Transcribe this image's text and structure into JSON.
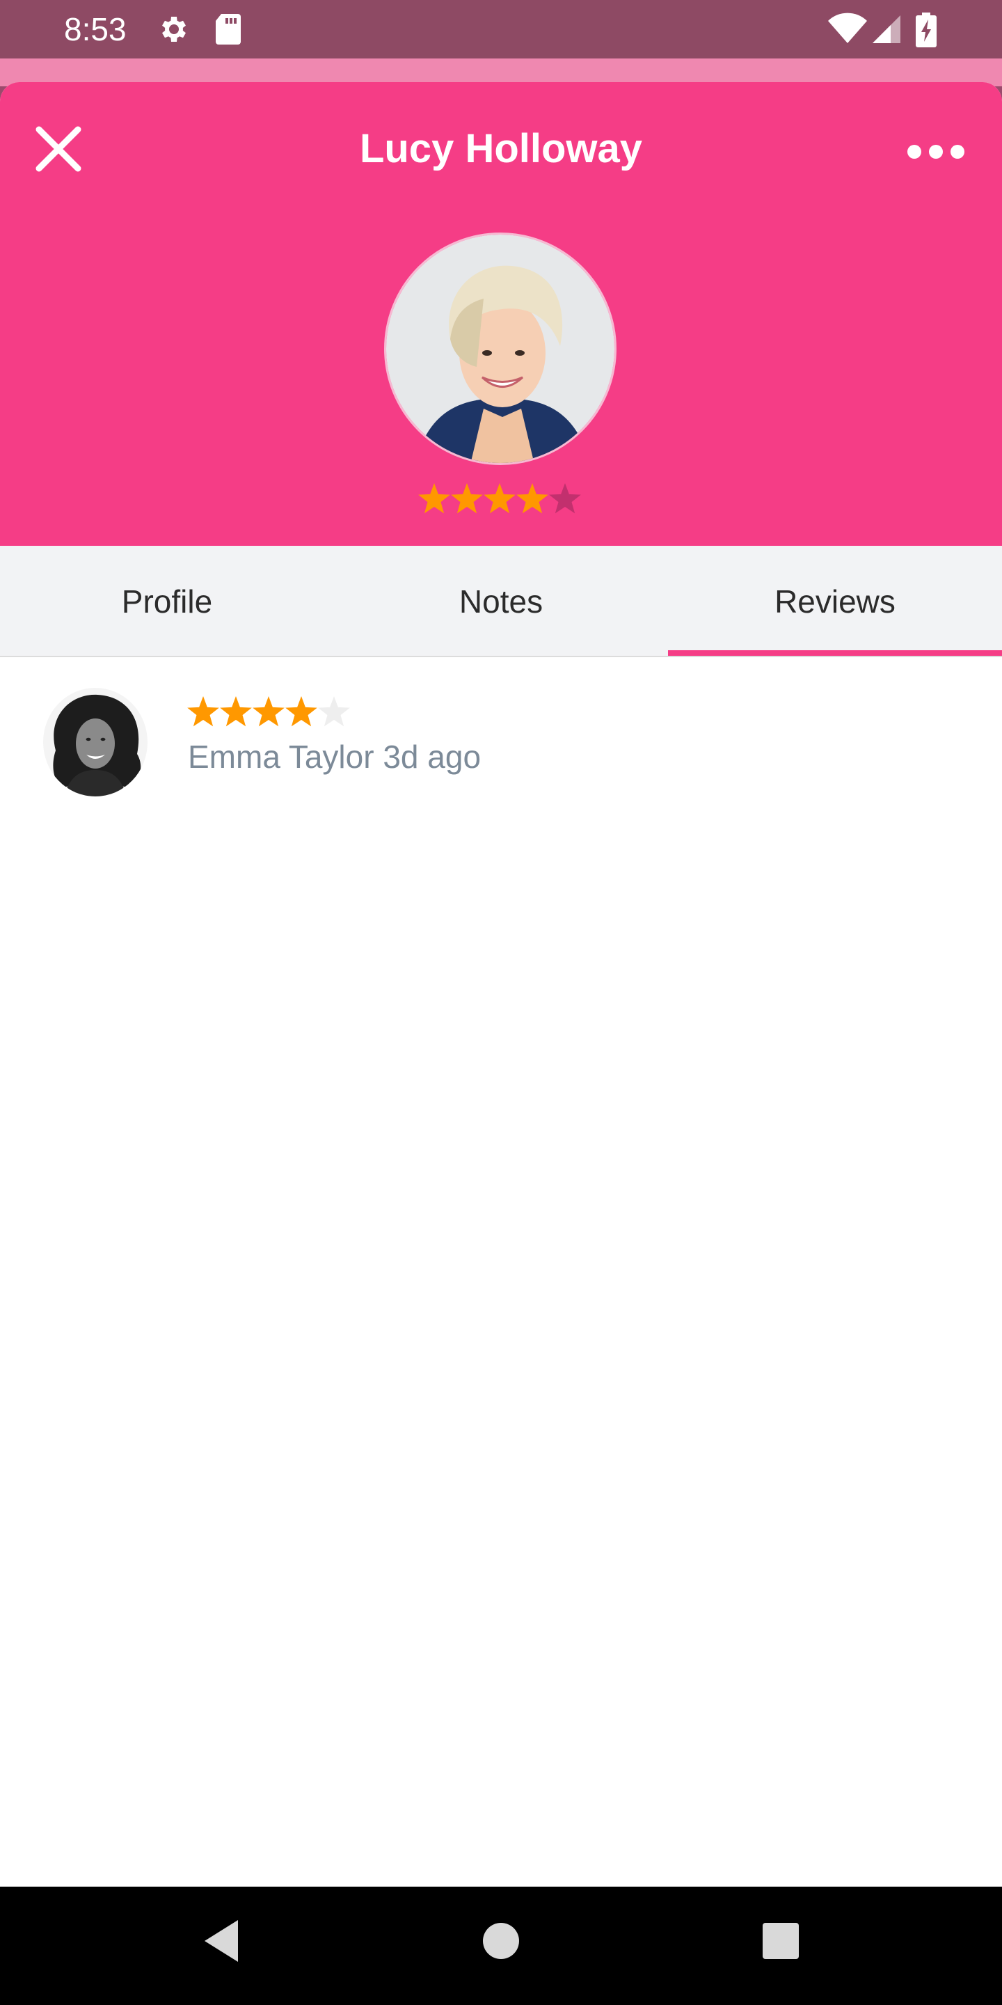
{
  "status_bar": {
    "time": "8:53",
    "icons": [
      "gear-icon",
      "sd-card-icon",
      "wifi-icon",
      "signal-icon",
      "battery-charging-icon"
    ]
  },
  "header": {
    "title": "Lucy Holloway",
    "close_icon": "close-icon",
    "more_icon": "more-horizontal-icon",
    "rating": 4,
    "rating_max": 5,
    "bg_color": "#f53d86"
  },
  "tabs": {
    "items": [
      {
        "label": "Profile",
        "active": false
      },
      {
        "label": "Notes",
        "active": false
      },
      {
        "label": "Reviews",
        "active": true
      }
    ],
    "accent": "#f53d86"
  },
  "reviews": [
    {
      "reviewer": "Emma Taylor",
      "when": "3d ago",
      "meta": "Emma Taylor 3d ago",
      "rating": 4,
      "rating_max": 5
    }
  ],
  "colors": {
    "star_filled": "#ff9800",
    "star_empty_header": "#c2306e",
    "star_empty_list": "#eeeeee",
    "meta_text": "#7c8a98"
  },
  "nav_bar": {
    "icons": [
      "back-triangle-icon",
      "home-circle-icon",
      "recents-square-icon"
    ]
  }
}
